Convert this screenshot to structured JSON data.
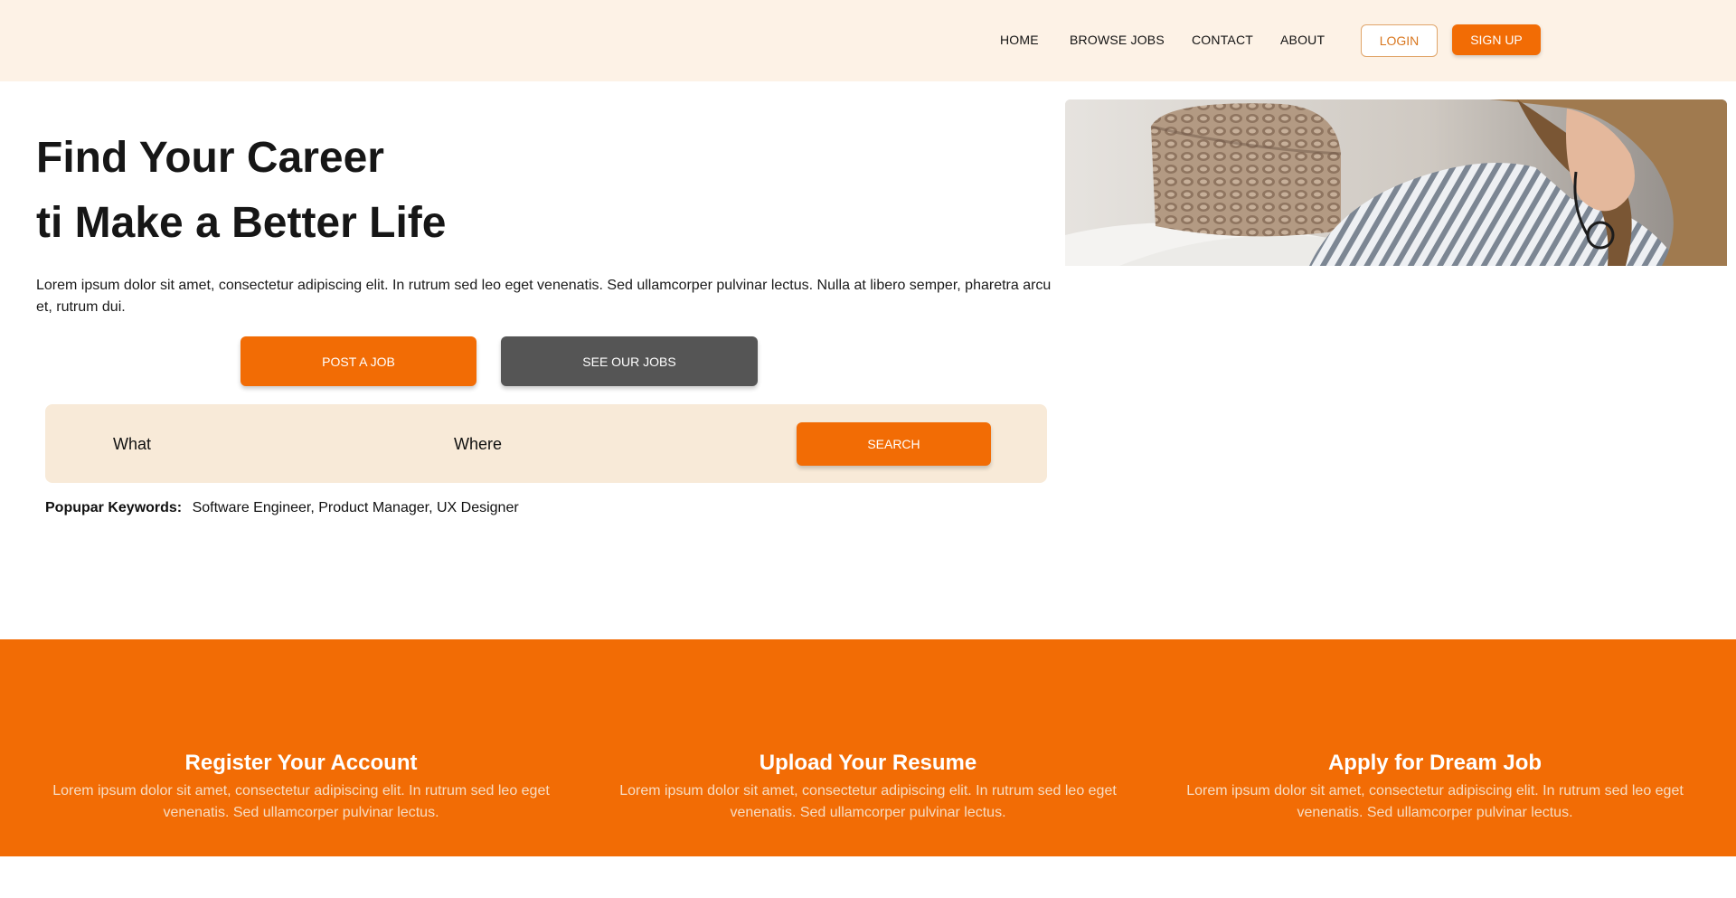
{
  "nav": {
    "home": "HOME",
    "browse_jobs": "BROWSE JOBS",
    "contact": "CONTACT",
    "about": "ABOUT",
    "login": "LOGIN",
    "signup": "SIGN UP"
  },
  "hero": {
    "title_line1": "Find Your Career",
    "title_line2": "ti Make a Better Life",
    "description": "Lorem ipsum dolor sit amet, consectetur adipiscing elit. In rutrum sed leo eget venenatis. Sed ullamcorper pulvinar lectus. Nulla at libero semper, pharetra arcu et, rutrum dui.",
    "post_job": "POST A JOB",
    "see_jobs": "SEE OUR JOBS"
  },
  "search": {
    "what": "What",
    "where": "Where",
    "button": "SEARCH"
  },
  "keywords": {
    "label": "Popupar Keywords:",
    "values": "Software Engineer, Product Manager, UX Designer"
  },
  "steps": [
    {
      "title": "Register Your Account",
      "description": "Lorem ipsum dolor sit amet, consectetur adipiscing elit. In rutrum sed leo eget venenatis. Sed ullamcorper pulvinar lectus."
    },
    {
      "title": "Upload Your Resume",
      "description": "Lorem ipsum dolor sit amet, consectetur adipiscing elit. In rutrum sed leo eget venenatis. Sed ullamcorper pulvinar lectus."
    },
    {
      "title": "Apply for Dream Job",
      "description": "Lorem ipsum dolor sit amet, consectetur adipiscing elit. In rutrum sed leo eget venenatis. Sed ullamcorper pulvinar lectus."
    }
  ],
  "colors": {
    "accent": "#f26c05",
    "header_bg": "#fdf2e6",
    "search_bg": "#f8ead8",
    "secondary_button": "#555555"
  }
}
